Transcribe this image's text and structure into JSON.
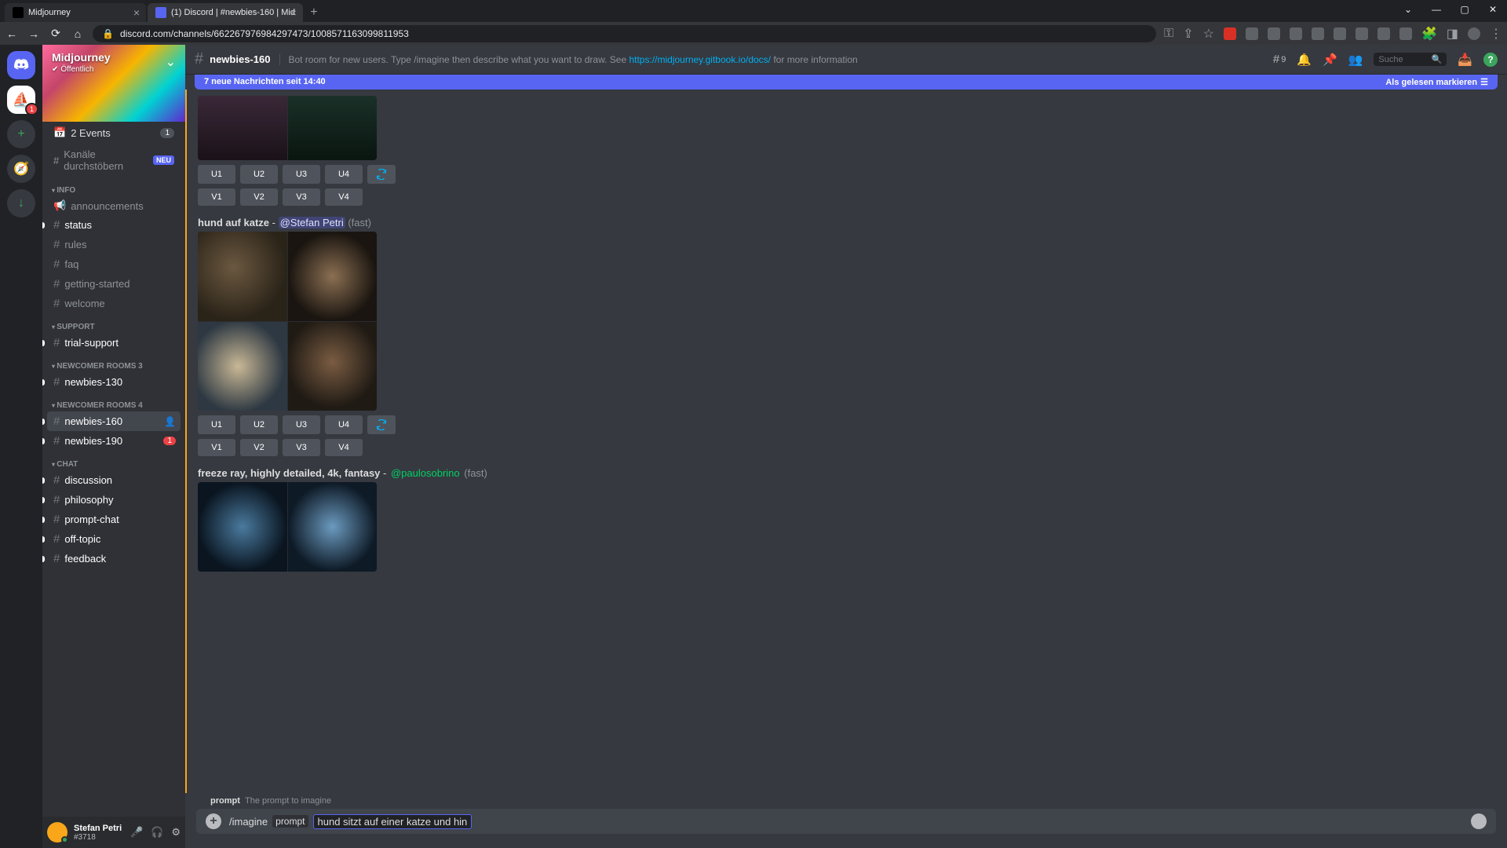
{
  "browser": {
    "tabs": [
      {
        "title": "Midjourney"
      },
      {
        "title": "(1) Discord | #newbies-160 | Mid"
      }
    ],
    "url": "discord.com/channels/662267976984297473/1008571163099811953",
    "window_controls": {
      "min": "—",
      "max": "▢",
      "close": "✕"
    }
  },
  "server": {
    "name": "Midjourney",
    "public_label": "Öffentlich"
  },
  "sidebar": {
    "events_label": "2 Events",
    "events_count": "1",
    "browse_label": "Kanäle durchstöbern",
    "browse_badge": "NEU",
    "categories": [
      {
        "name": "INFO",
        "channels": [
          {
            "name": "announcements",
            "icon": "speaker",
            "unread": false
          },
          {
            "name": "status",
            "icon": "hash",
            "unread": true
          },
          {
            "name": "rules",
            "icon": "hash",
            "unread": false
          },
          {
            "name": "faq",
            "icon": "hash",
            "unread": false
          },
          {
            "name": "getting-started",
            "icon": "hash",
            "unread": false
          },
          {
            "name": "welcome",
            "icon": "hash",
            "unread": false
          }
        ]
      },
      {
        "name": "SUPPORT",
        "channels": [
          {
            "name": "trial-support",
            "icon": "hash",
            "unread": true
          }
        ]
      },
      {
        "name": "NEWCOMER ROOMS 3",
        "channels": [
          {
            "name": "newbies-130",
            "icon": "hash",
            "unread": true
          }
        ]
      },
      {
        "name": "NEWCOMER ROOMS 4",
        "channels": [
          {
            "name": "newbies-160",
            "icon": "hash",
            "unread": true,
            "active": true
          },
          {
            "name": "newbies-190",
            "icon": "hash",
            "unread": true,
            "badge": "1"
          }
        ]
      },
      {
        "name": "CHAT",
        "channels": [
          {
            "name": "discussion",
            "icon": "hash",
            "unread": true
          },
          {
            "name": "philosophy",
            "icon": "hash",
            "unread": true
          },
          {
            "name": "prompt-chat",
            "icon": "hash",
            "unread": true
          },
          {
            "name": "off-topic",
            "icon": "hash",
            "unread": true
          },
          {
            "name": "feedback",
            "icon": "hash",
            "unread": true
          }
        ]
      }
    ]
  },
  "user": {
    "name": "Stefan Petri",
    "tag": "#3718"
  },
  "header": {
    "channel": "newbies-160",
    "topic_pre": "Bot room for new users. Type /imagine then describe what you want to draw. See ",
    "topic_link": "https://midjourney.gitbook.io/docs/",
    "topic_post": " for more information",
    "threads_count": "9",
    "search_placeholder": "Suche"
  },
  "new_messages": {
    "text": "7 neue Nachrichten seit 14:40",
    "mark_read": "Als gelesen markieren"
  },
  "messages": {
    "m1": {
      "buttons_u": [
        "U1",
        "U2",
        "U3",
        "U4"
      ],
      "buttons_v": [
        "V1",
        "V2",
        "V3",
        "V4"
      ]
    },
    "m2": {
      "prompt": "hund auf katze",
      "user": "@Stefan Petri",
      "mode": "(fast)",
      "buttons_u": [
        "U1",
        "U2",
        "U3",
        "U4"
      ],
      "buttons_v": [
        "V1",
        "V2",
        "V3",
        "V4"
      ]
    },
    "m3": {
      "prompt": "freeze ray, highly detailed, 4k, fantasy",
      "user": "@paulosobrino",
      "mode": "(fast)"
    }
  },
  "input": {
    "hint_label": "prompt",
    "hint_desc": "The prompt to imagine",
    "command": "/imagine",
    "param_label": "prompt",
    "value": "hund sitzt auf einer katze und hin"
  }
}
